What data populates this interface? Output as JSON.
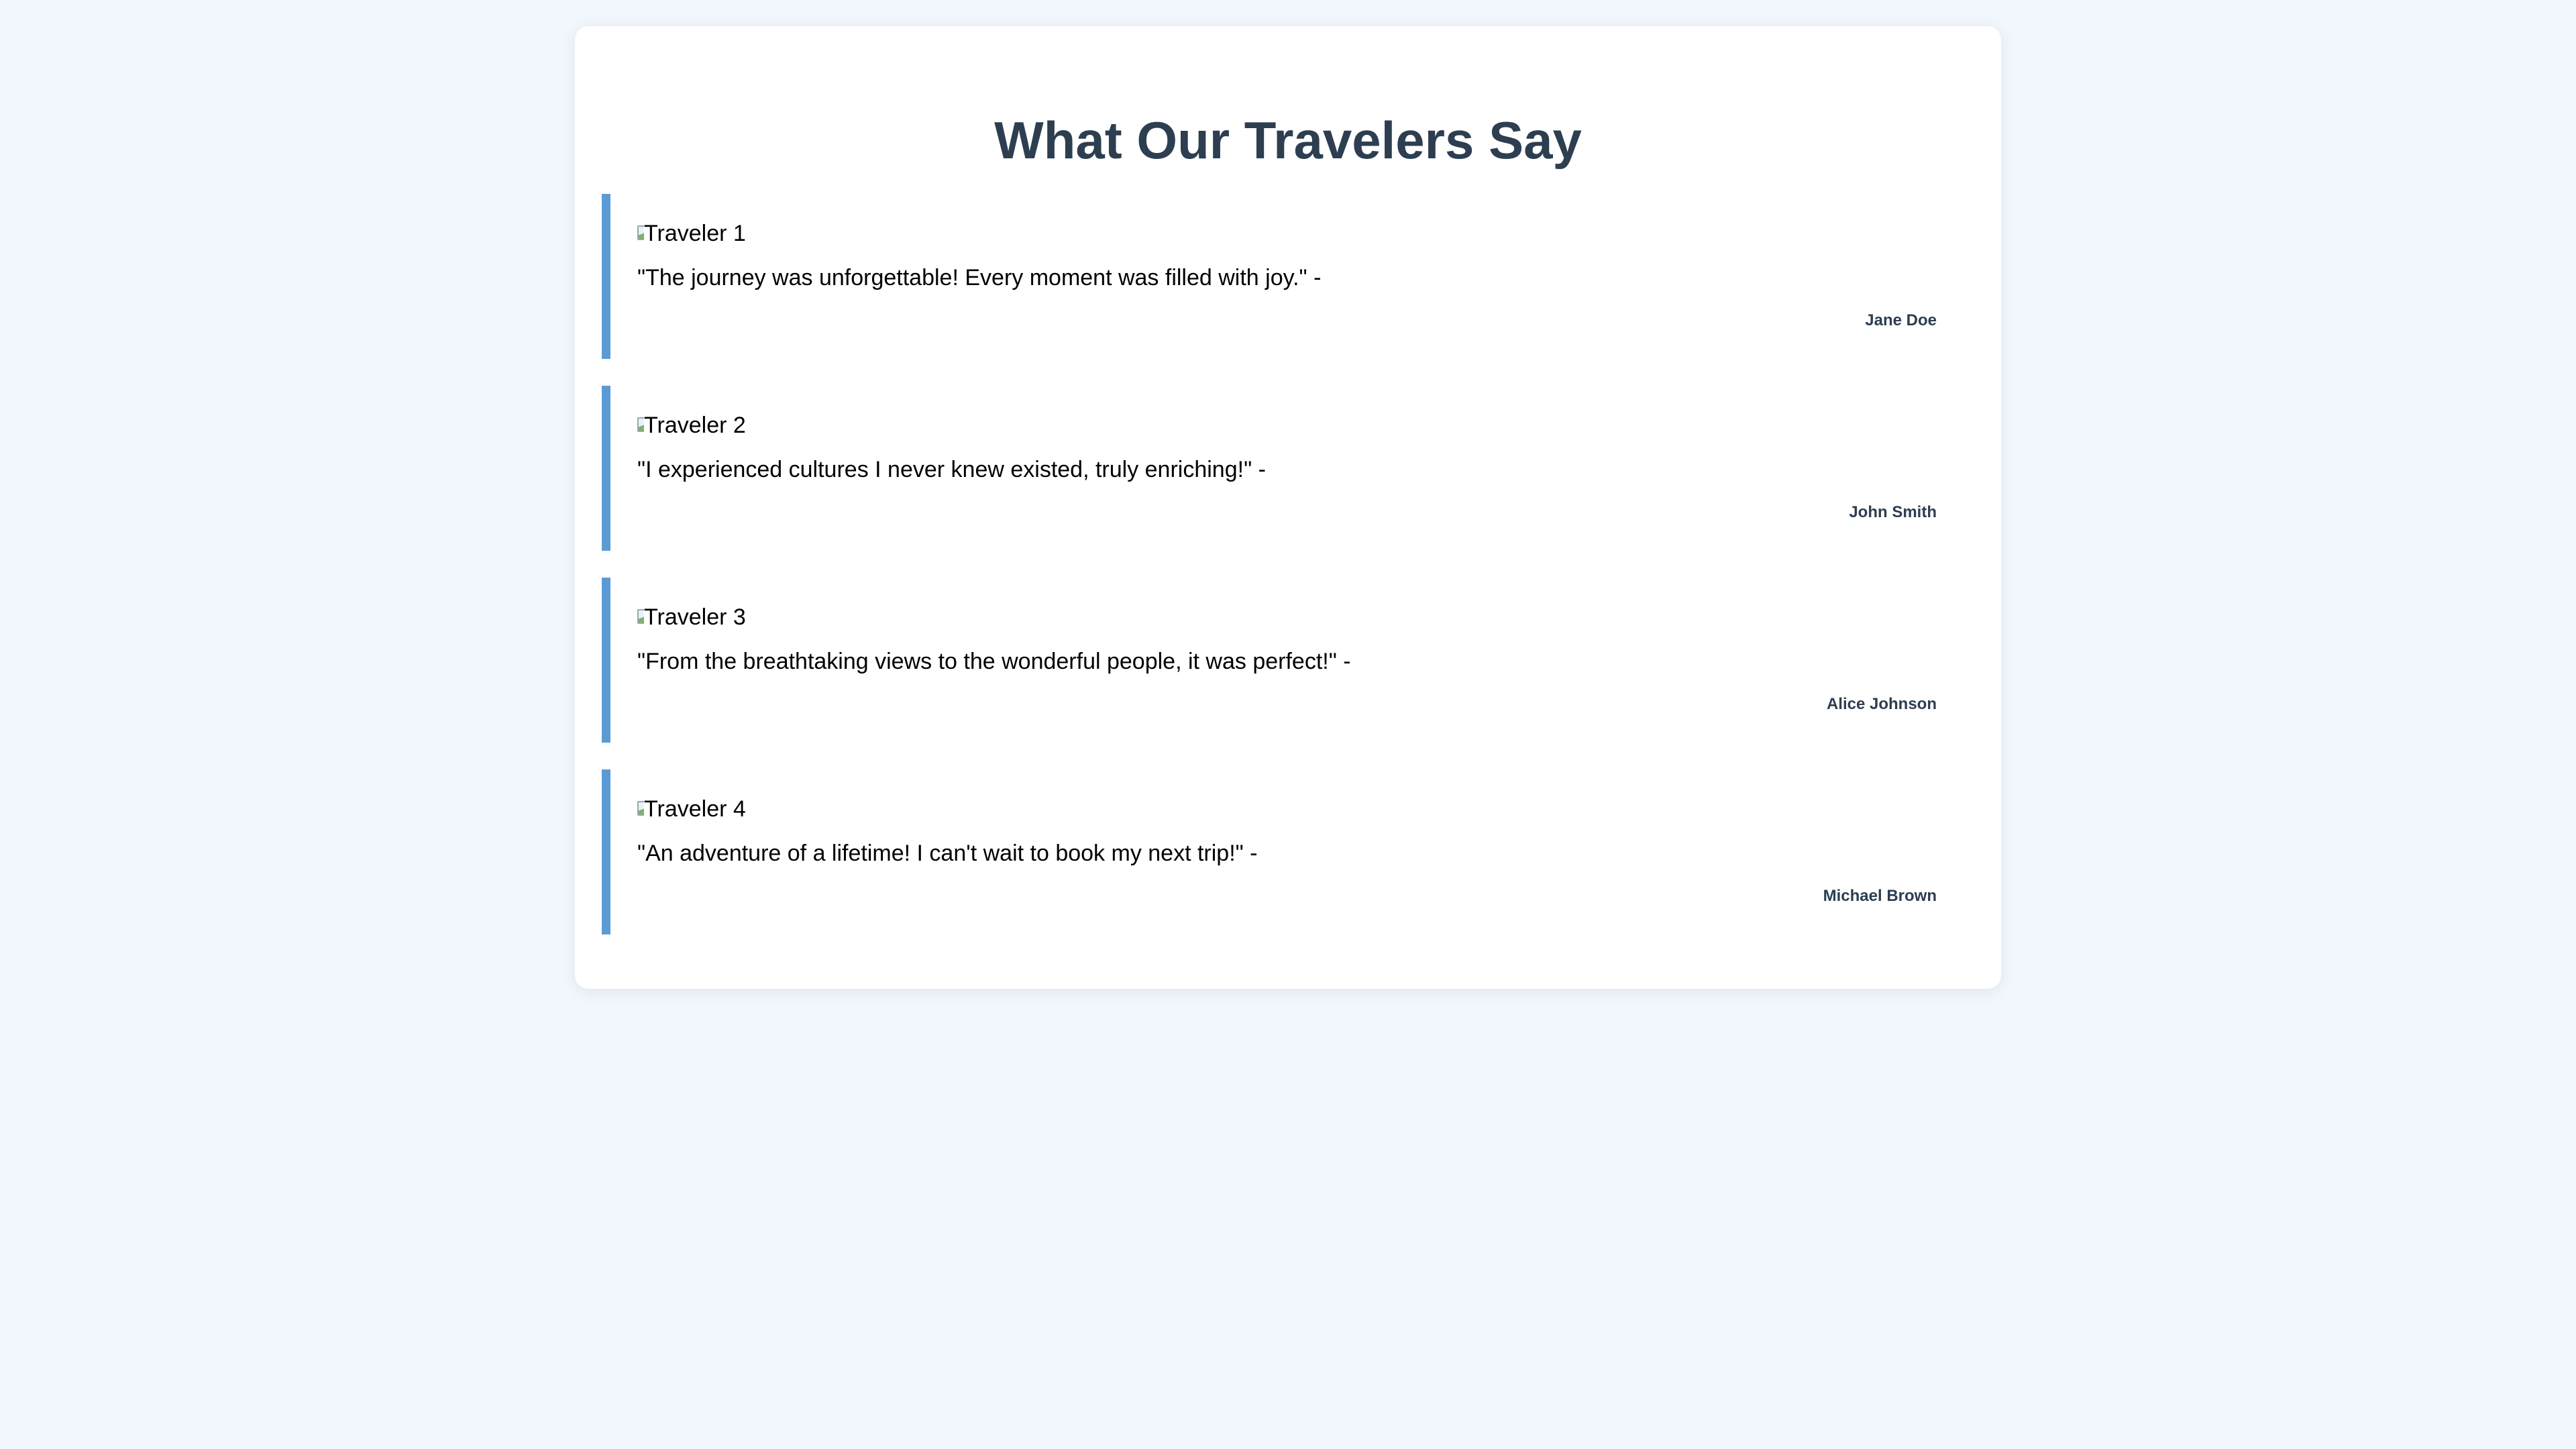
{
  "page": {
    "title": "What Our Travelers Say"
  },
  "colors": {
    "background": "#f2f6fd",
    "card": "#ffffff",
    "title": "#2d3e50",
    "accent_border": "#5b9bd5",
    "author": "#2d3e50"
  },
  "testimonials": [
    {
      "image_alt": "Traveler 1",
      "quote": "\"The journey was unforgettable! Every moment was filled with joy.\" -",
      "author": "Jane Doe"
    },
    {
      "image_alt": "Traveler 2",
      "quote": "\"I experienced cultures I never knew existed, truly enriching!\" -",
      "author": "John Smith"
    },
    {
      "image_alt": "Traveler 3",
      "quote": "\"From the breathtaking views to the wonderful people, it was perfect!\" -",
      "author": "Alice Johnson"
    },
    {
      "image_alt": "Traveler 4",
      "quote": "\"An adventure of a lifetime! I can't wait to book my next trip!\" -",
      "author": "Michael Brown"
    }
  ]
}
